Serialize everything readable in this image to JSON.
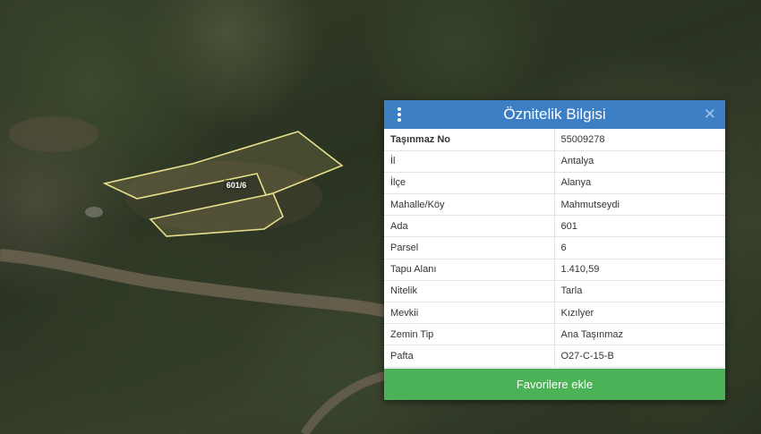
{
  "map": {
    "parcel_label": "601/6"
  },
  "panel": {
    "title": "Öznitelik Bilgisi",
    "rows": [
      {
        "key": "Taşınmaz No",
        "value": "55009278"
      },
      {
        "key": "İl",
        "value": "Antalya"
      },
      {
        "key": "İlçe",
        "value": "Alanya"
      },
      {
        "key": "Mahalle/Köy",
        "value": "Mahmutseydi"
      },
      {
        "key": "Ada",
        "value": "601"
      },
      {
        "key": "Parsel",
        "value": "6"
      },
      {
        "key": "Tapu Alanı",
        "value": "1.410,59"
      },
      {
        "key": "Nitelik",
        "value": "Tarla"
      },
      {
        "key": "Mevkii",
        "value": "Kızılyer"
      },
      {
        "key": "Zemin Tip",
        "value": "Ana Taşınmaz"
      },
      {
        "key": "Pafta",
        "value": "O27-C-15-B"
      }
    ],
    "favorite_button": "Favorilere ekle",
    "close_glyph": "✕"
  },
  "colors": {
    "header": "#3d7fc4",
    "button": "#4cb257",
    "parcel_outline": "#e8e08a"
  }
}
